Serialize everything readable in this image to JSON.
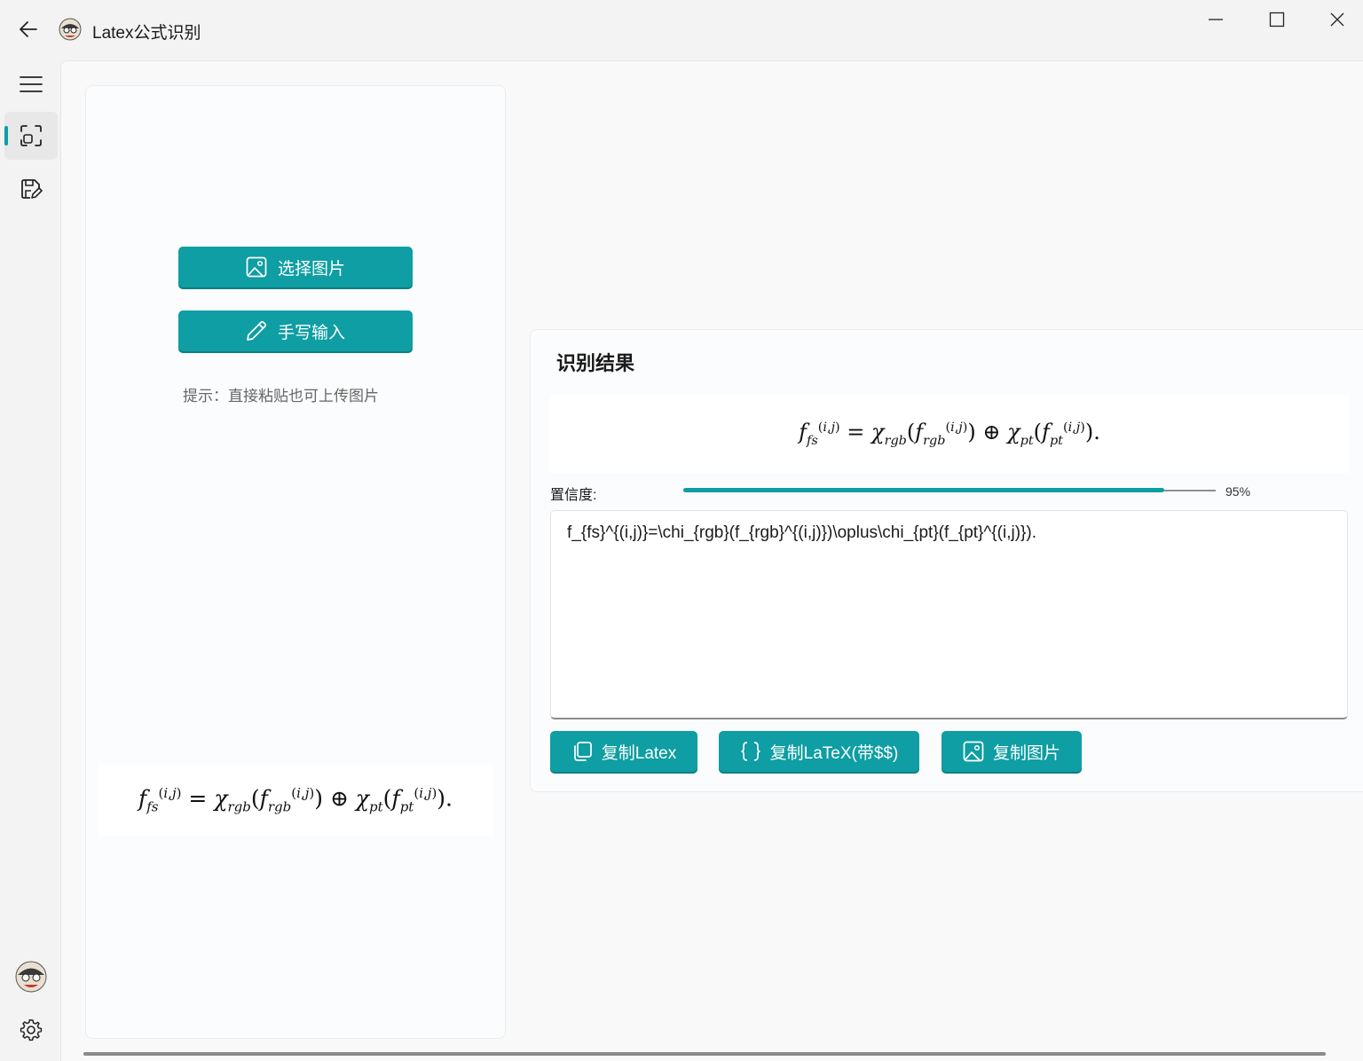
{
  "window": {
    "title": "Latex公式识别",
    "icons": {
      "back": "back-arrow-icon",
      "logo": "app-logo-icon",
      "minimize": "minimize-icon",
      "maximize": "maximize-icon",
      "close": "close-icon"
    }
  },
  "sidebar": {
    "items": [
      {
        "name": "menu",
        "icon": "hamburger-menu-icon"
      },
      {
        "name": "ocr",
        "icon": "scan-icon",
        "selected": true
      },
      {
        "name": "saved",
        "icon": "save-edit-icon"
      },
      {
        "name": "avatar",
        "icon": "avatar-icon"
      },
      {
        "name": "settings",
        "icon": "gear-icon"
      }
    ]
  },
  "left_panel": {
    "select_image_label": "选择图片",
    "handwrite_label": "手写输入",
    "hint": "提示：直接粘贴也可上传图片"
  },
  "result": {
    "title": "识别结果",
    "confidence_label": "置信度:",
    "confidence_value": "95%",
    "confidence": 0.95,
    "latex_text": "f_{fs}^{(i,j)}=\\chi_{rgb}(f_{rgb}^{(i,j)})\\oplus\\chi_{pt}(f_{pt}^{(i,j)}).",
    "buttons": {
      "copy_latex": "复制Latex",
      "copy_latex_dollar": "复制LaTeX(带$$)",
      "copy_image": "复制图片"
    }
  },
  "colors": {
    "accent": "#0e9ea3",
    "background": "#f3f3f3",
    "card": "#fbfcfd"
  }
}
